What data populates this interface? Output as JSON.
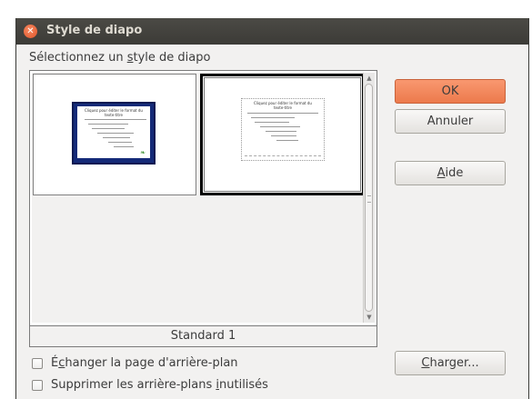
{
  "window": {
    "title": "Style de diapo"
  },
  "prompt": {
    "pre": "Sélectionnez un ",
    "u": "s",
    "post": "tyle de diapo"
  },
  "styles": [
    {
      "name": "Standard 1",
      "selected": false,
      "theme": "blue-border",
      "slide": {
        "title_line1": "Cliquez pour éditer le format du",
        "title_line2": "texte-titre",
        "outline": "Cliquez pour éditer le format du plan de texte"
      }
    },
    {
      "name": "Standard 1",
      "selected": true,
      "theme": "plain-white",
      "slide": {
        "title_line1": "Cliquez pour éditer le format du",
        "title_line2": "texte-titre",
        "outline": "Cliquez pour éditer le format du plan de texte"
      }
    }
  ],
  "selected_name": "Standard 1",
  "buttons": {
    "ok": "OK",
    "cancel": "Annuler",
    "help": {
      "u": "A",
      "rest": "ide"
    },
    "load": {
      "u": "C",
      "rest": "harger..."
    }
  },
  "options": {
    "swap_bg": {
      "pre": "É",
      "u": "c",
      "post": "hanger la page d'arrière-plan",
      "checked": false
    },
    "remove_unused": {
      "pre": "Supprimer les arrière-plans ",
      "u": "i",
      "post": "nutilisés",
      "checked": false
    }
  },
  "colors": {
    "ok_button": "#ec7a4c",
    "titlebar": "#3c3b37",
    "slide_border_blue": "#142a78"
  },
  "icons": {
    "close": "close-icon",
    "scroll_up": "arrow-up-icon",
    "scroll_down": "arrow-down-icon"
  }
}
